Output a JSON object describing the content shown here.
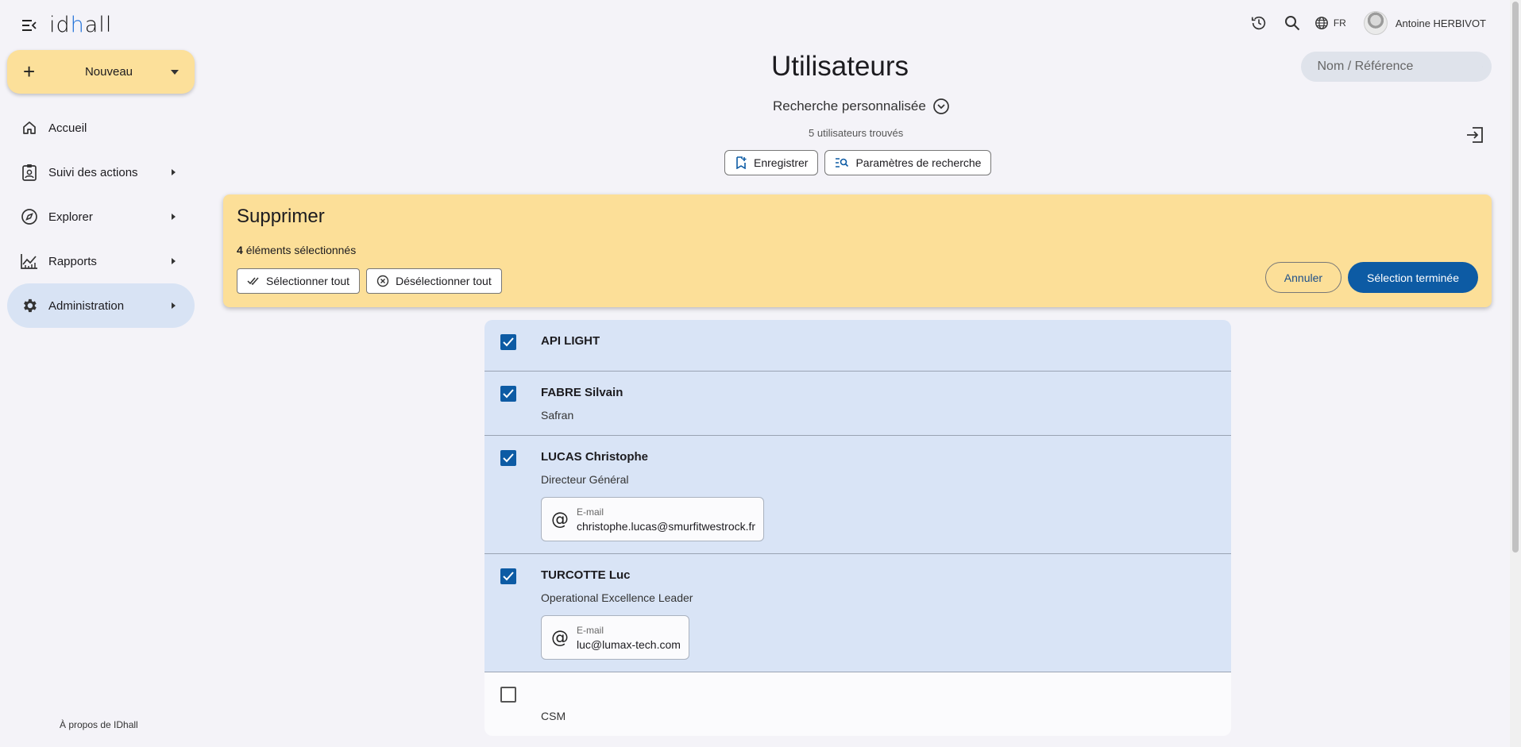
{
  "app": {
    "logo": "idhall",
    "logo_prefix": "id",
    "logo_dot": "h",
    "logo_suffix": "all"
  },
  "sidebar": {
    "new_button": "Nouveau",
    "items": [
      {
        "label": "Accueil",
        "icon": "home-icon",
        "has_submenu": false
      },
      {
        "label": "Suivi des actions",
        "icon": "clipboard-user-icon",
        "has_submenu": true
      },
      {
        "label": "Explorer",
        "icon": "compass-icon",
        "has_submenu": true
      },
      {
        "label": "Rapports",
        "icon": "chart-icon",
        "has_submenu": true
      },
      {
        "label": "Administration",
        "icon": "gear-icon",
        "has_submenu": true,
        "active": true
      }
    ],
    "about": "À propos de IDhall"
  },
  "topbar": {
    "language": "FR",
    "user_name": "Antoine HERBIVOT",
    "search_placeholder": "Nom / Référence"
  },
  "header": {
    "title": "Utilisateurs",
    "search_mode": "Recherche personnalisée",
    "count_number": "5",
    "count_text": "utilisateurs trouvés",
    "save_button": "Enregistrer",
    "params_button": "Paramètres de recherche"
  },
  "banner": {
    "title": "Supprimer",
    "selected_count": "4",
    "selected_text": "éléments sélectionnés",
    "select_all": "Sélectionner tout",
    "deselect_all": "Désélectionner tout",
    "cancel": "Annuler",
    "done": "Sélection terminée"
  },
  "users": [
    {
      "name": "API LIGHT",
      "subtitle": "",
      "email_label": "",
      "email": "",
      "checked": true
    },
    {
      "name": "FABRE Silvain",
      "subtitle": "Safran",
      "email_label": "",
      "email": "",
      "checked": true
    },
    {
      "name": "LUCAS Christophe",
      "subtitle": "Directeur Général",
      "email_label": "E-mail",
      "email": "christophe.lucas@smurfitwestrock.fr",
      "checked": true
    },
    {
      "name": "TURCOTTE Luc",
      "subtitle": "Operational Excellence Leader",
      "email_label": "E-mail",
      "email": "luc@lumax-tech.com",
      "checked": true
    },
    {
      "name": "",
      "subtitle": "CSM",
      "email_label": "",
      "email": "",
      "checked": false
    }
  ],
  "colors": {
    "accent": "#0d5ba4",
    "banner": "#fcdf98",
    "selected_row": "#d9e4f6",
    "active_nav": "#d8e3f4"
  }
}
